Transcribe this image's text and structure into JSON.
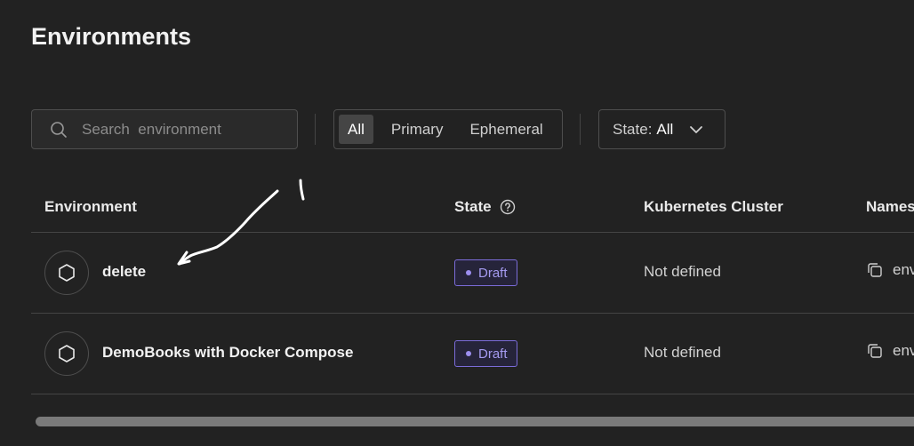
{
  "page": {
    "title": "Environments"
  },
  "search": {
    "placeholder": "Search  environment",
    "value": ""
  },
  "filters": {
    "tabs": [
      {
        "label": "All",
        "active": true
      },
      {
        "label": "Primary",
        "active": false
      },
      {
        "label": "Ephemeral",
        "active": false
      }
    ],
    "state": {
      "prefix": "State:",
      "value": "All"
    }
  },
  "table": {
    "columns": [
      "Environment",
      "State",
      "Kubernetes Cluster",
      "Names"
    ],
    "rows": [
      {
        "name": "delete",
        "state": "Draft",
        "cluster": "Not defined",
        "namespace": "env"
      },
      {
        "name": "DemoBooks with Docker Compose",
        "state": "Draft",
        "cluster": "Not defined",
        "namespace": "env"
      }
    ]
  },
  "colors": {
    "background": "#222222",
    "border": "#4e4e4e",
    "draft_badge": "#7b6cd9",
    "annotation": "#ffffff"
  },
  "icons": [
    "search-icon",
    "chevron-down-icon",
    "help-circle-icon",
    "hexagon-icon",
    "copy-icon"
  ]
}
